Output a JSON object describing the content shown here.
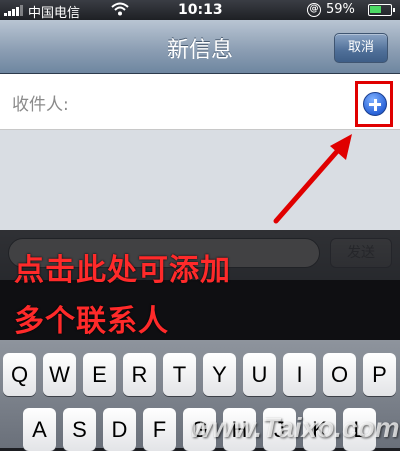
{
  "status_bar": {
    "carrier": "中国电信",
    "time": "10:13",
    "lock_symbol": "@",
    "battery_percent": "59%",
    "battery_level": 0.59
  },
  "nav": {
    "title": "新信息",
    "cancel_label": "取消"
  },
  "compose": {
    "recipient_label": "收件人:",
    "send_label": "发送"
  },
  "annotation": {
    "line1": "点击此处可添加",
    "line2": "多个联系人",
    "color": "#ff2a2a"
  },
  "keyboard": {
    "row1": [
      "Q",
      "W",
      "E",
      "R",
      "T",
      "Y",
      "U",
      "I",
      "O",
      "P"
    ],
    "row2": [
      "A",
      "S",
      "D",
      "F",
      "G",
      "H",
      "J",
      "K",
      "L"
    ]
  },
  "watermark": "www.Taixo.com"
}
